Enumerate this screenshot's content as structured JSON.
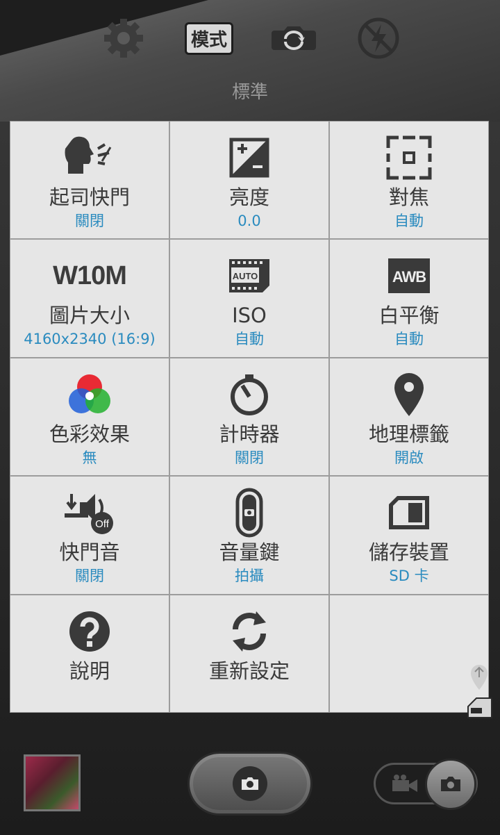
{
  "top_bar": {
    "mode_button_label": "模式",
    "mode_name": "標準"
  },
  "settings": [
    {
      "title": "起司快門",
      "value": "關閉",
      "icon": "face-voice-icon"
    },
    {
      "title": "亮度",
      "value": "0.0",
      "icon": "exposure-icon"
    },
    {
      "title": "對焦",
      "value": "自動",
      "icon": "focus-frame-icon"
    },
    {
      "title": "圖片大小",
      "value": "4160x2340 (16:9)",
      "icon_text": "W10M",
      "icon": "resolution-icon"
    },
    {
      "title": "ISO",
      "value": "自動",
      "icon_text": "AUTO",
      "icon": "iso-auto-icon"
    },
    {
      "title": "白平衡",
      "value": "自動",
      "icon_text": "AWB",
      "icon": "awb-icon"
    },
    {
      "title": "色彩效果",
      "value": "無",
      "icon": "color-circles-icon"
    },
    {
      "title": "計時器",
      "value": "關閉",
      "icon": "timer-icon"
    },
    {
      "title": "地理標籤",
      "value": "開啟",
      "icon": "location-pin-icon"
    },
    {
      "title": "快門音",
      "value": "關閉",
      "icon_text": "Off",
      "icon": "shutter-sound-off-icon"
    },
    {
      "title": "音量鍵",
      "value": "拍攝",
      "icon": "volume-key-icon"
    },
    {
      "title": "儲存裝置",
      "value": "SD 卡",
      "icon": "sd-card-icon"
    },
    {
      "title": "說明",
      "value": "",
      "icon": "help-icon"
    },
    {
      "title": "重新設定",
      "value": "",
      "icon": "reset-icon"
    }
  ],
  "colors": {
    "value_text": "#2a8bbf",
    "cell_bg": "#e6e6e6",
    "title_text": "#3a3a3a"
  }
}
